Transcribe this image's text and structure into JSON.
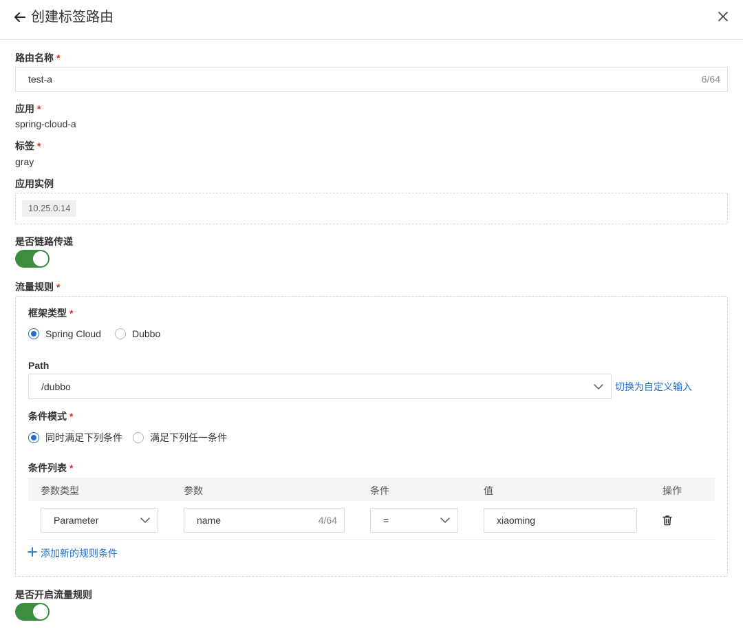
{
  "header": {
    "title": "创建标签路由",
    "back_icon": "arrow-left-icon",
    "close_icon": "close-icon"
  },
  "route_name": {
    "label": "路由名称",
    "required": "*",
    "value": "test-a",
    "count": "6/64"
  },
  "app": {
    "label": "应用",
    "required": "*",
    "value": "spring-cloud-a"
  },
  "tag": {
    "label": "标签",
    "required": "*",
    "value": "gray"
  },
  "instances": {
    "label": "应用实例",
    "items": [
      "10.25.0.14"
    ]
  },
  "chain_pass": {
    "label": "是否链路传递",
    "enabled": true
  },
  "traffic_rules": {
    "label": "流量规则",
    "required": "*",
    "framework": {
      "label": "框架类型",
      "required": "*",
      "options": [
        "Spring Cloud",
        "Dubbo"
      ],
      "selected": "Spring Cloud"
    },
    "path": {
      "label": "Path",
      "value": "/dubbo",
      "switch_link": "切换为自定义输入"
    },
    "condition_mode": {
      "label": "条件模式",
      "required": "*",
      "options": [
        "同时满足下列条件",
        "满足下列任一条件"
      ],
      "selected": "同时满足下列条件"
    },
    "condition_list": {
      "label": "条件列表",
      "required": "*",
      "columns": [
        "参数类型",
        "参数",
        "条件",
        "值",
        "操作"
      ],
      "rows": [
        {
          "param_type": "Parameter",
          "param": "name",
          "param_count": "4/64",
          "operator": "=",
          "value": "xiaoming"
        }
      ],
      "add_link": "添加新的规则条件"
    }
  },
  "enable_traffic_rules": {
    "label": "是否开启流量规则",
    "enabled": true
  },
  "colors": {
    "accent": "#1f6fd0",
    "switch_on": "#3d8c40",
    "required": "#d93026"
  }
}
